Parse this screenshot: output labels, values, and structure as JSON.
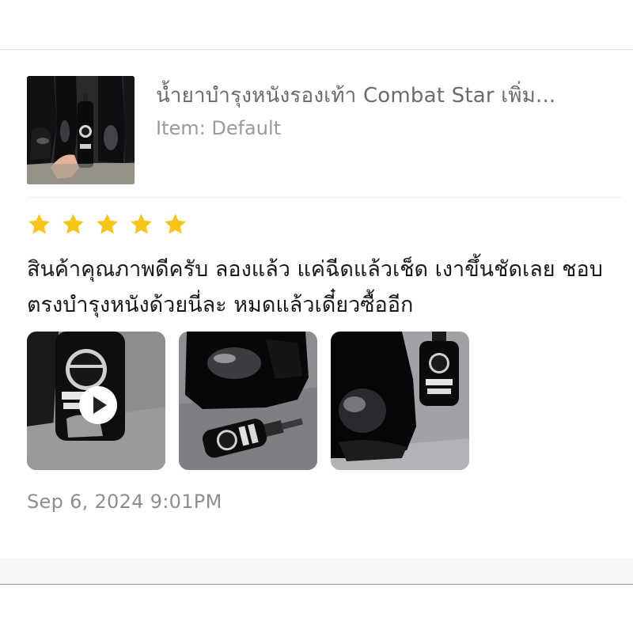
{
  "product": {
    "title": "น้ำยาบำรุงหนังรองเท้า Combat Star เพิ่ม...",
    "variant": "Item: Default",
    "thumb_icon": "product-photo-boots-spray"
  },
  "review": {
    "rating": 5,
    "max_rating": 5,
    "star_color": "#f5c518",
    "text": "สินค้าคุณภาพดีครับ ลองแล้ว แค่ฉีดแล้วเช็ด เงาขึ้นชัดเลย ชอบตรงบำรุงหนังด้วยนี่ละ หมดแล้วเดี๋ยวซื้ออีก",
    "date": "Sep 6, 2024 9:01PM",
    "media": [
      {
        "type": "video",
        "icon": "play-icon"
      },
      {
        "type": "photo"
      },
      {
        "type": "photo"
      }
    ]
  }
}
